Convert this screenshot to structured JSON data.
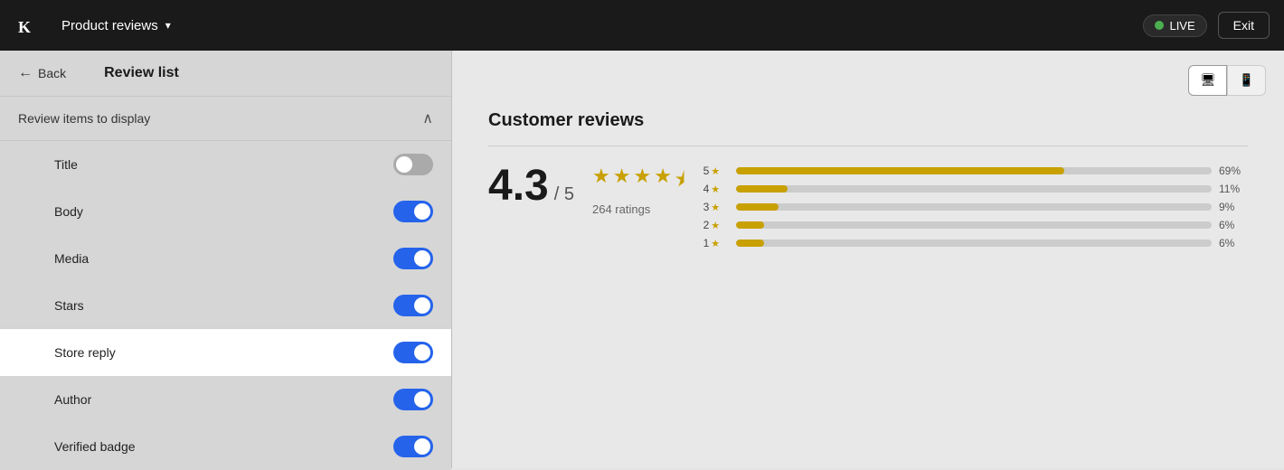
{
  "topnav": {
    "logo_alt": "Klaviyo",
    "product_title": "Product reviews",
    "chevron": "▾",
    "live_label": "LIVE",
    "exit_label": "Exit"
  },
  "left_panel": {
    "back_label": "Back",
    "panel_title": "Review list",
    "section_title": "Review items to display",
    "toggles": [
      {
        "label": "Title",
        "on": false,
        "highlighted": false
      },
      {
        "label": "Body",
        "on": true,
        "highlighted": false
      },
      {
        "label": "Media",
        "on": true,
        "highlighted": false
      },
      {
        "label": "Stars",
        "on": true,
        "highlighted": false
      },
      {
        "label": "Store reply",
        "on": true,
        "highlighted": true
      },
      {
        "label": "Author",
        "on": true,
        "highlighted": false
      },
      {
        "label": "Verified badge",
        "on": true,
        "highlighted": false
      }
    ]
  },
  "right_panel": {
    "preview_heading": "Customer reviews",
    "rating_number": "4.3",
    "rating_denom": "/ 5",
    "rating_count": "264 ratings",
    "stars": [
      "full",
      "full",
      "full",
      "full",
      "half"
    ],
    "bars": [
      {
        "label": "5",
        "pct": 69,
        "pct_label": "69%"
      },
      {
        "label": "4",
        "pct": 11,
        "pct_label": "11%"
      },
      {
        "label": "3",
        "pct": 9,
        "pct_label": "9%"
      },
      {
        "label": "2",
        "pct": 6,
        "pct_label": "6%"
      },
      {
        "label": "1",
        "pct": 6,
        "pct_label": "6%"
      }
    ]
  },
  "icons": {
    "monitor": "🖥",
    "mobile": "📱",
    "back_arrow": "←",
    "chevron_up": "∧",
    "star_full": "★",
    "star_half": "⯨"
  }
}
